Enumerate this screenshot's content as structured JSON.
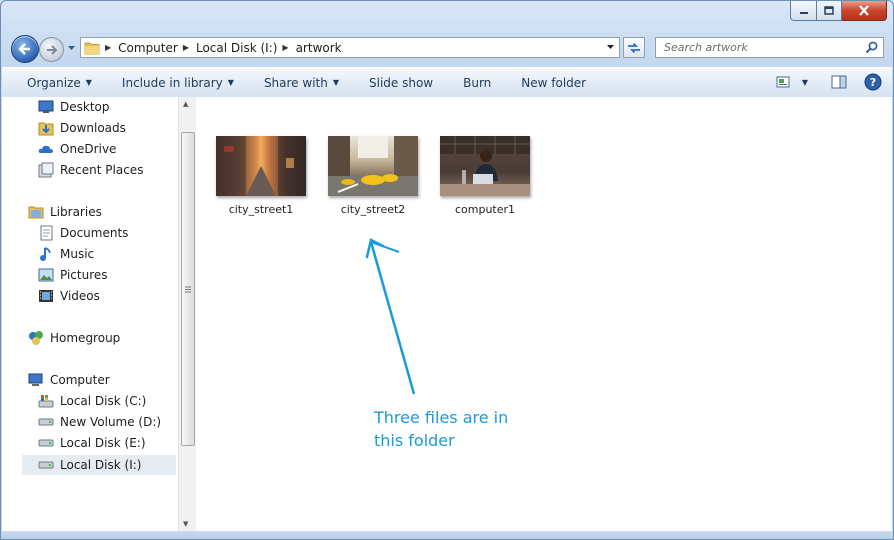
{
  "window": {
    "caption": {
      "minimize_icon": "minimize-icon",
      "maximize_icon": "maximize-icon",
      "close_icon": "close-icon"
    }
  },
  "nav": {
    "back_icon": "back-arrow-icon",
    "forward_icon": "forward-arrow-icon",
    "breadcrumb": [
      "Computer",
      "Local Disk (I:)",
      "artwork"
    ],
    "search_placeholder": "Search artwork"
  },
  "toolbar": {
    "commands": [
      {
        "label": "Organize",
        "has_dropdown": true
      },
      {
        "label": "Include in library",
        "has_dropdown": true
      },
      {
        "label": "Share with",
        "has_dropdown": true
      },
      {
        "label": "Slide show",
        "has_dropdown": false
      },
      {
        "label": "Burn",
        "has_dropdown": false
      },
      {
        "label": "New folder",
        "has_dropdown": false
      }
    ]
  },
  "sidebar": {
    "items": [
      {
        "label": "Desktop",
        "icon": "desktop-icon"
      },
      {
        "label": "Downloads",
        "icon": "downloads-icon"
      },
      {
        "label": "OneDrive",
        "icon": "onedrive-icon"
      },
      {
        "label": "Recent Places",
        "icon": "recent-places-icon"
      },
      {
        "label": "Libraries",
        "icon": "libraries-icon"
      },
      {
        "label": "Documents",
        "icon": "documents-icon"
      },
      {
        "label": "Music",
        "icon": "music-icon"
      },
      {
        "label": "Pictures",
        "icon": "pictures-icon"
      },
      {
        "label": "Videos",
        "icon": "videos-icon"
      },
      {
        "label": "Homegroup",
        "icon": "homegroup-icon"
      },
      {
        "label": "Computer",
        "icon": "computer-icon"
      },
      {
        "label": "Local Disk (C:)",
        "icon": "system-drive-icon"
      },
      {
        "label": "New Volume (D:)",
        "icon": "drive-icon"
      },
      {
        "label": "Local Disk (E:)",
        "icon": "drive-icon"
      },
      {
        "label": "Local Disk (I:)",
        "icon": "drive-icon",
        "selected": true
      }
    ]
  },
  "files": [
    {
      "name": "city_street1"
    },
    {
      "name": "city_street2"
    },
    {
      "name": "computer1"
    }
  ],
  "annotation": {
    "line1": "Three files are in",
    "line2": "this folder",
    "color": "#1a9bd7"
  },
  "colors": {
    "accent": "#1a9bd7",
    "close_button": "#c9452b"
  }
}
